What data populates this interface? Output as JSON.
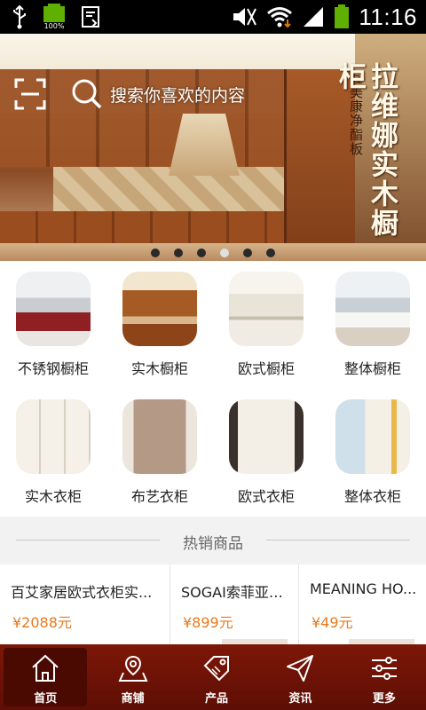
{
  "status_bar": {
    "time": "11:16",
    "battery_percent": "100%",
    "icons": [
      "usb-icon",
      "battery-full-icon",
      "download-icon",
      "mute-icon",
      "wifi-icon",
      "signal-icon",
      "battery-icon"
    ]
  },
  "banner": {
    "title": "拉维娜实木橱柜",
    "subtitle": "宜美康净酯板",
    "active_slide_index": 3,
    "slide_count": 6
  },
  "search": {
    "placeholder": "搜索你喜欢的内容",
    "icon": "search-icon",
    "scan_icon": "scan-icon"
  },
  "categories": [
    {
      "label": "不锈钢橱柜",
      "icon": "stainless-kitchen-image"
    },
    {
      "label": "实木橱柜",
      "icon": "solid-wood-kitchen-image"
    },
    {
      "label": "欧式橱柜",
      "icon": "european-kitchen-image"
    },
    {
      "label": "整体橱柜",
      "icon": "integrated-kitchen-image"
    },
    {
      "label": "实木衣柜",
      "icon": "solid-wood-wardrobe-image"
    },
    {
      "label": "布艺衣柜",
      "icon": "fabric-wardrobe-image"
    },
    {
      "label": "欧式衣柜",
      "icon": "european-wardrobe-image"
    },
    {
      "label": "整体衣柜",
      "icon": "integrated-wardrobe-image"
    }
  ],
  "hot": {
    "title": "热销商品",
    "products": [
      {
        "name": "百艾家居欧式衣柜实...",
        "price": "¥2088元"
      },
      {
        "name": "SOGAI索菲亚衣...",
        "price": "¥899元"
      },
      {
        "name": "MEANING HO...",
        "price": "¥49元"
      }
    ]
  },
  "tabs": [
    {
      "label": "首页",
      "icon": "home-icon",
      "active": true
    },
    {
      "label": "商铺",
      "icon": "shop-map-icon",
      "active": false
    },
    {
      "label": "产品",
      "icon": "sale-tag-icon",
      "active": false
    },
    {
      "label": "资讯",
      "icon": "paper-plane-icon",
      "active": false
    },
    {
      "label": "更多",
      "icon": "sliders-icon",
      "active": false
    }
  ],
  "colors": {
    "tab_bar": "#6e1206",
    "price": "#e8791c"
  }
}
